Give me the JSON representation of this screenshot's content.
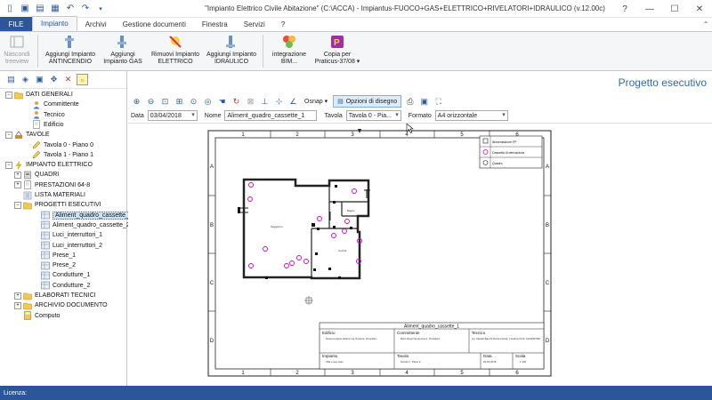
{
  "window": {
    "title": "\"Impianto Elettrico Civile Abitazione\" (C:\\ACCA) - Impiantus-FUOCO+GAS+ELETTRICO+RIVELATORI+IDRAULICO (v.12.00c)",
    "controls": {
      "help": "?",
      "minimize": "—",
      "maximize": "☐",
      "close": "✕"
    }
  },
  "quick_access": [
    "new-document-icon",
    "save-icon",
    "open-icon",
    "save-as-icon",
    "undo-icon",
    "redo-icon",
    "customize-icon"
  ],
  "menu": {
    "file": "FILE",
    "tabs": [
      "Impianto",
      "Archivi",
      "Gestione documenti",
      "Finestra",
      "Servizi",
      "?"
    ],
    "active_tab": "Impianto"
  },
  "ribbon": {
    "buttons": [
      {
        "label1": "Nascondi",
        "label2": "treeview",
        "disabled": true
      },
      {
        "label1": "Aggiungi Impianto",
        "label2": "ANTINCENDIO"
      },
      {
        "label1": "Aggiungi",
        "label2": "Impianto GAS"
      },
      {
        "label1": "Rimuovi Impianto",
        "label2": "ELETTRICO"
      },
      {
        "label1": "Aggiungi Impianto",
        "label2": "IDRAULICO"
      },
      {
        "label1": "integrazione",
        "label2": "BIM..."
      },
      {
        "label1": "Copia per",
        "label2": "Praticus-37/08 ▾"
      }
    ]
  },
  "tree": {
    "items": [
      {
        "label": "DATI GENERALI",
        "level": 0,
        "toggle": "−",
        "icon": "folder"
      },
      {
        "label": "Committente",
        "level": 2,
        "icon": "person"
      },
      {
        "label": "Tecnico",
        "level": 2,
        "icon": "person"
      },
      {
        "label": "Edificio",
        "level": 2,
        "icon": "doc"
      },
      {
        "label": "TAVOLE",
        "level": 0,
        "toggle": "−",
        "icon": "tools"
      },
      {
        "label": "Tavola 0 - Piano 0",
        "level": 2,
        "icon": "pencil"
      },
      {
        "label": "Tavola 1 - Piano 1",
        "level": 2,
        "icon": "pencil"
      },
      {
        "label": "IMPIANTO ELETTRICO",
        "level": 0,
        "toggle": "−",
        "icon": "bolt"
      },
      {
        "label": "QUADRI",
        "level": 1,
        "toggle": "+",
        "icon": "box"
      },
      {
        "label": "PRESTAZIONI 64-8",
        "level": 1,
        "toggle": "+",
        "icon": "doc"
      },
      {
        "label": "LISTA MATERIALI",
        "level": 1,
        "icon": "list"
      },
      {
        "label": "PROGETTI ESECUTIVI",
        "level": 1,
        "toggle": "−",
        "icon": "folder"
      },
      {
        "label": "Aliment_quadro_cassette_1",
        "level": 3,
        "icon": "grid",
        "selected": true
      },
      {
        "label": "Aliment_quadro_cassette_2",
        "level": 3,
        "icon": "grid"
      },
      {
        "label": "Luci_interruttori_1",
        "level": 3,
        "icon": "grid"
      },
      {
        "label": "Luci_interruttori_2",
        "level": 3,
        "icon": "grid"
      },
      {
        "label": "Prese_1",
        "level": 3,
        "icon": "grid"
      },
      {
        "label": "Prese_2",
        "level": 3,
        "icon": "grid"
      },
      {
        "label": "Condutture_1",
        "level": 3,
        "icon": "grid"
      },
      {
        "label": "Condutture_2",
        "level": 3,
        "icon": "grid"
      },
      {
        "label": "ELABORATI TECNICI",
        "level": 1,
        "toggle": "+",
        "icon": "folder"
      },
      {
        "label": "ARCHIVIO DOCUMENTO",
        "level": 1,
        "toggle": "+",
        "icon": "folder"
      },
      {
        "label": "Computo",
        "level": 1,
        "icon": "calc"
      }
    ]
  },
  "main": {
    "title": "Progetto esecutivo",
    "osnap_label": "Osnap",
    "options_label": "Opzioni di disegno",
    "form": {
      "data_label": "Data",
      "data_value": "03/04/2018",
      "nome_label": "Nome",
      "nome_value": "Aliment_quadro_cassette_1",
      "tavola_label": "Tavola",
      "tavola_value": "Tavola 0 - Pia...",
      "formato_label": "Formato",
      "formato_value": "A4 orizzontale"
    }
  },
  "drawing": {
    "col_numbers": [
      "1",
      "2",
      "3",
      "4",
      "5",
      "6"
    ],
    "row_letters": [
      "A",
      "B",
      "C",
      "D"
    ],
    "legend": [
      "Alimentazione FP",
      "Cassetta di derivazione",
      "Quadro"
    ],
    "room_labels": [
      "Soggiorno",
      "Cucina",
      "Bagno"
    ],
    "titleblock": {
      "title": "Aliment_quadro_cassette_1",
      "edificio_label": "Edificio",
      "edificio_text": "Nuova impianto elettrico Via di Garcia, 15 Avellino",
      "committente_label": "Committente",
      "committente_text": "Mario Rossi Via dei Gurno, 15 Avellino",
      "tecnico_label": "Tecnico",
      "tecnico_text": "Ing. Claudio Bianchi Piazza Libertà, 1 Avellino P.IVA: 01234567890",
      "impianto_label": "Impianto",
      "impianto_text": "Villa a due piani",
      "tavola_label": "Tavola",
      "tavola_text": "Tavola 0 - Piano 0",
      "data_label": "Data",
      "data_text": "03-04-2018",
      "scala_label": "Scala",
      "scala_text": "1:100"
    }
  },
  "status": {
    "label": "Licenza:"
  },
  "colors": {
    "accent": "#2b579a",
    "symbol": "#d400d4",
    "title_blue": "#2b6cb0"
  }
}
